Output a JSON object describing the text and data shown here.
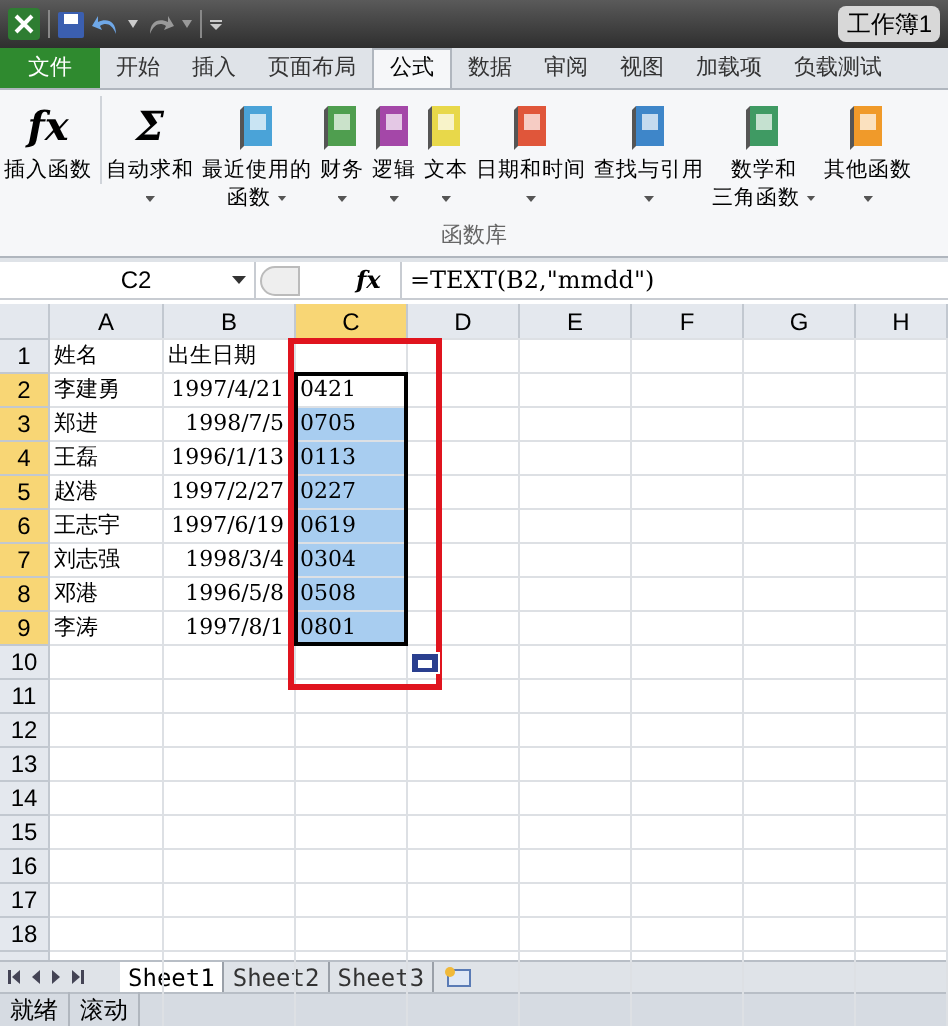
{
  "window": {
    "title": "工作簿1"
  },
  "tabs": [
    {
      "label": "文件",
      "kind": "file",
      "selected": false
    },
    {
      "label": "开始",
      "kind": "tab",
      "selected": false
    },
    {
      "label": "插入",
      "kind": "tab",
      "selected": false
    },
    {
      "label": "页面布局",
      "kind": "tab",
      "selected": false
    },
    {
      "label": "公式",
      "kind": "tab",
      "selected": true
    },
    {
      "label": "数据",
      "kind": "tab",
      "selected": false
    },
    {
      "label": "审阅",
      "kind": "tab",
      "selected": false
    },
    {
      "label": "视图",
      "kind": "tab",
      "selected": false
    },
    {
      "label": "加载项",
      "kind": "tab",
      "selected": false
    },
    {
      "label": "负载测试",
      "kind": "tab",
      "selected": false
    }
  ],
  "ribbon": {
    "group_label": "函数库",
    "buttons": [
      {
        "kind": "glyph",
        "glyph": "fx",
        "lines": [
          "插入函数"
        ],
        "dropdown": false
      },
      {
        "kind": "glyph",
        "glyph": "Σ",
        "lines": [
          "自动求和"
        ],
        "dropdown": true
      },
      {
        "kind": "book",
        "color": "#4aa3d8",
        "lines": [
          "最近使用的",
          "函数"
        ],
        "dropdown": true
      },
      {
        "kind": "book",
        "color": "#4f9e4f",
        "lines": [
          "财务"
        ],
        "dropdown": true
      },
      {
        "kind": "book",
        "color": "#a447a8",
        "lines": [
          "逻辑"
        ],
        "dropdown": true
      },
      {
        "kind": "book",
        "color": "#e8d84a",
        "lines": [
          "文本"
        ],
        "dropdown": true
      },
      {
        "kind": "book",
        "color": "#e0563a",
        "lines": [
          "日期和时间"
        ],
        "dropdown": true
      },
      {
        "kind": "book",
        "color": "#3e86c9",
        "lines": [
          "查找与引用"
        ],
        "dropdown": true
      },
      {
        "kind": "book",
        "color": "#3f9a63",
        "lines": [
          "数学和",
          "三角函数"
        ],
        "dropdown": true
      },
      {
        "kind": "book",
        "color": "#f09a2a",
        "lines": [
          "其他函数"
        ],
        "dropdown": true
      }
    ]
  },
  "formula_bar": {
    "name_box": "C2",
    "fx": "fx",
    "formula": "=TEXT(B2,\"mmdd\")"
  },
  "columns": [
    {
      "label": "A",
      "selected": false
    },
    {
      "label": "B",
      "selected": false
    },
    {
      "label": "C",
      "selected": true
    },
    {
      "label": "D",
      "selected": false
    },
    {
      "label": "E",
      "selected": false
    },
    {
      "label": "F",
      "selected": false
    },
    {
      "label": "G",
      "selected": false
    },
    {
      "label": "H",
      "selected": false
    }
  ],
  "rows": [
    {
      "label": "1",
      "kind": "header",
      "selected": false,
      "A": "姓名",
      "B": "出生日期"
    },
    {
      "label": "2",
      "kind": "data",
      "selected": true,
      "A": "李建勇",
      "B": "1997/4/21",
      "C": "0421"
    },
    {
      "label": "3",
      "kind": "data",
      "selected": true,
      "A": "郑进",
      "B": "1998/7/5",
      "C": "0705"
    },
    {
      "label": "4",
      "kind": "data",
      "selected": true,
      "A": "王磊",
      "B": "1996/1/13",
      "C": "0113"
    },
    {
      "label": "5",
      "kind": "data",
      "selected": true,
      "A": "赵港",
      "B": "1997/2/27",
      "C": "0227"
    },
    {
      "label": "6",
      "kind": "data",
      "selected": true,
      "A": "王志宇",
      "B": "1997/6/19",
      "C": "0619"
    },
    {
      "label": "7",
      "kind": "data",
      "selected": true,
      "A": "刘志强",
      "B": "1998/3/4",
      "C": "0304"
    },
    {
      "label": "8",
      "kind": "data",
      "selected": true,
      "A": "邓港",
      "B": "1996/5/8",
      "C": "0508"
    },
    {
      "label": "9",
      "kind": "data",
      "selected": true,
      "A": "李涛",
      "B": "1997/8/1",
      "C": "0801"
    },
    {
      "label": "10",
      "kind": "data",
      "selected": false
    },
    {
      "label": "11",
      "kind": "data",
      "selected": false
    },
    {
      "label": "12",
      "kind": "data",
      "selected": false
    },
    {
      "label": "13",
      "kind": "data",
      "selected": false
    },
    {
      "label": "14",
      "kind": "data",
      "selected": false
    },
    {
      "label": "15",
      "kind": "data",
      "selected": false
    },
    {
      "label": "16",
      "kind": "data",
      "selected": false
    },
    {
      "label": "17",
      "kind": "data",
      "selected": false
    },
    {
      "label": "18",
      "kind": "data",
      "selected": false
    }
  ],
  "sheet_tabs": [
    {
      "label": "Sheet1",
      "selected": true
    },
    {
      "label": "Sheet2",
      "selected": false
    },
    {
      "label": "Sheet3",
      "selected": false
    }
  ],
  "status_bar": [
    "就绪",
    "滚动"
  ]
}
